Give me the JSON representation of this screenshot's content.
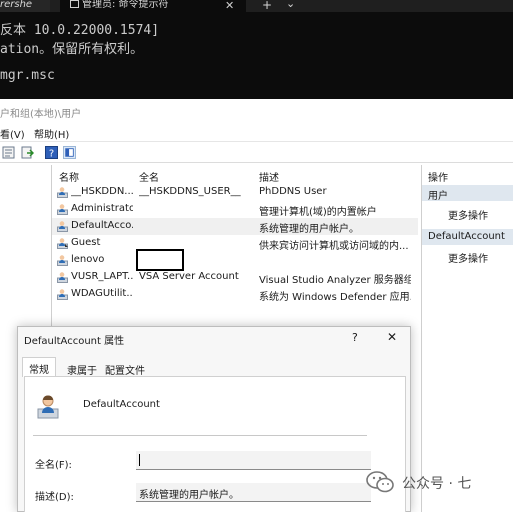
{
  "terminal": {
    "tabs": [
      {
        "label": "rershe"
      },
      {
        "label": "管理员: 命令提示符"
      }
    ],
    "close_glyph": "✕",
    "new_tab_glyph": "+",
    "dropdown_glyph": "⌄",
    "lines": [
      "反本 10.0.22000.1574]",
      "ation。保留所有权利。",
      "",
      "mgr.msc"
    ]
  },
  "mmc": {
    "title_path": "户和组(本地)\\用户",
    "menu": {
      "view": "看(V)",
      "help": "帮助(H)"
    },
    "columns": {
      "name": "名称",
      "fullname": "全名",
      "desc": "描述"
    },
    "users": [
      {
        "name": "__HSKDDN...",
        "fullname": "__HSKDDNS_USER__",
        "desc": "PhDDNS User",
        "selected": false
      },
      {
        "name": "Administrator",
        "fullname": "",
        "desc": "管理计算机(域)的内置帐户",
        "selected": false
      },
      {
        "name": "DefaultAcco...",
        "fullname": "",
        "desc": "系统管理的用户帐户。",
        "selected": true
      },
      {
        "name": "Guest",
        "fullname": "",
        "desc": "供来宾访问计算机或访问域的内...",
        "selected": false
      },
      {
        "name": "lenovo",
        "fullname": "",
        "desc": "",
        "selected": false
      },
      {
        "name": "VUSR_LAPT...",
        "fullname": "VSA Server Account",
        "desc": "Visual Studio Analyzer 服务器组...",
        "selected": false
      },
      {
        "name": "WDAGUtilit...",
        "fullname": "",
        "desc": "系统为 Windows Defender 应用...",
        "selected": false
      }
    ],
    "actions": {
      "header": "操作",
      "section1": "用户",
      "more1": "更多操作",
      "section2": "DefaultAccount",
      "more2": "更多操作"
    }
  },
  "dialog": {
    "title": "DefaultAccount 属性",
    "help_glyph": "?",
    "close_glyph": "✕",
    "tabs": [
      "常规",
      "隶属于",
      "配置文件"
    ],
    "account_name": "DefaultAccount",
    "fullname_label": "全名(F):",
    "fullname_value": "",
    "desc_label": "描述(D):",
    "desc_value": "系统管理的用户帐户。"
  },
  "watermark": {
    "text": "公众号 · 七"
  }
}
